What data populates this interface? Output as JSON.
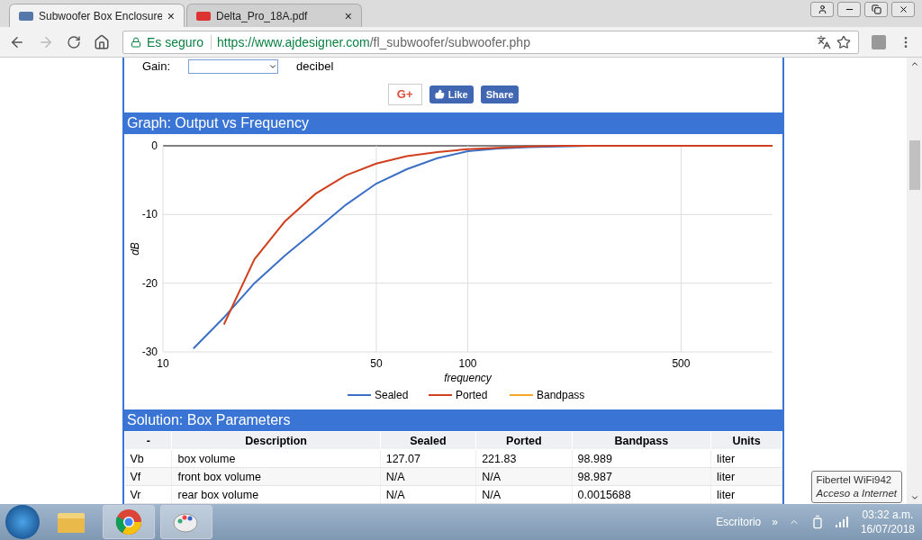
{
  "browser": {
    "tabs": [
      {
        "title": "Subwoofer Box Enclosure",
        "selected": true,
        "close": "×"
      },
      {
        "title": "Delta_Pro_18A.pdf",
        "selected": false,
        "close": "×"
      }
    ],
    "security": "Es seguro",
    "url_host": "https://www.ajdesigner.com",
    "url_path": "/fl_subwoofer/subwoofer.php"
  },
  "gain_row": {
    "label": "Gain:",
    "unit": "decibel"
  },
  "social": {
    "google": "G+",
    "like": "Like",
    "share": "Share"
  },
  "graph": {
    "title": "Graph: Output vs Frequency",
    "chart_data": {
      "type": "line",
      "xlabel": "frequency",
      "ylabel": "dB",
      "categories": [
        "10",
        null,
        null,
        null,
        null,
        null,
        null,
        "50",
        null,
        null,
        "100",
        null,
        null,
        null,
        null,
        null,
        null,
        "500",
        null,
        null,
        null
      ],
      "ylim": [
        -30,
        0
      ],
      "grid": true,
      "legend": "bottom",
      "yticks": [
        0,
        -10,
        -20,
        -30
      ],
      "series": [
        {
          "name": "Sealed",
          "color": "#3b6fc6",
          "values": [
            null,
            -29.5,
            -25,
            -20,
            -16,
            -12.3,
            -8.6,
            -5.5,
            -3.4,
            -1.8,
            -0.8,
            -0.4,
            -0.2,
            -0.1,
            0,
            0,
            null,
            null,
            null,
            null,
            null
          ]
        },
        {
          "name": "Ported",
          "color": "#d0401e",
          "values": [
            null,
            null,
            -26,
            -16.5,
            -11,
            -7,
            -4.3,
            -2.6,
            -1.5,
            -0.9,
            -0.5,
            -0.3,
            -0.1,
            0,
            0,
            0,
            0,
            0,
            0,
            0,
            0
          ]
        },
        {
          "name": "Bandpass",
          "color": "#f5a623",
          "values": [
            null,
            null,
            null,
            null,
            null,
            null,
            null,
            null,
            null,
            null,
            null,
            null,
            null,
            null,
            null,
            null,
            null,
            null,
            null,
            null,
            null
          ]
        }
      ]
    }
  },
  "solution": {
    "title": "Solution: Box Parameters",
    "columns": [
      "-",
      "Description",
      "Sealed",
      "Ported",
      "Bandpass",
      "Units"
    ],
    "rows": [
      [
        "Vb",
        "box volume",
        "127.07",
        "221.83",
        "98.989",
        "liter"
      ],
      [
        "Vf",
        "front box volume",
        "N/A",
        "N/A",
        "98.987",
        "liter"
      ],
      [
        "Vr",
        "rear box volume",
        "N/A",
        "N/A",
        "0.0015688",
        "liter"
      ]
    ]
  },
  "tooltip": {
    "network": "Fibertel WiFi942",
    "status": "Acceso a Internet"
  },
  "taskbar": {
    "desktop": "Escritorio",
    "more": "»",
    "time": "03:32 a.m.",
    "date": "16/07/2018"
  }
}
